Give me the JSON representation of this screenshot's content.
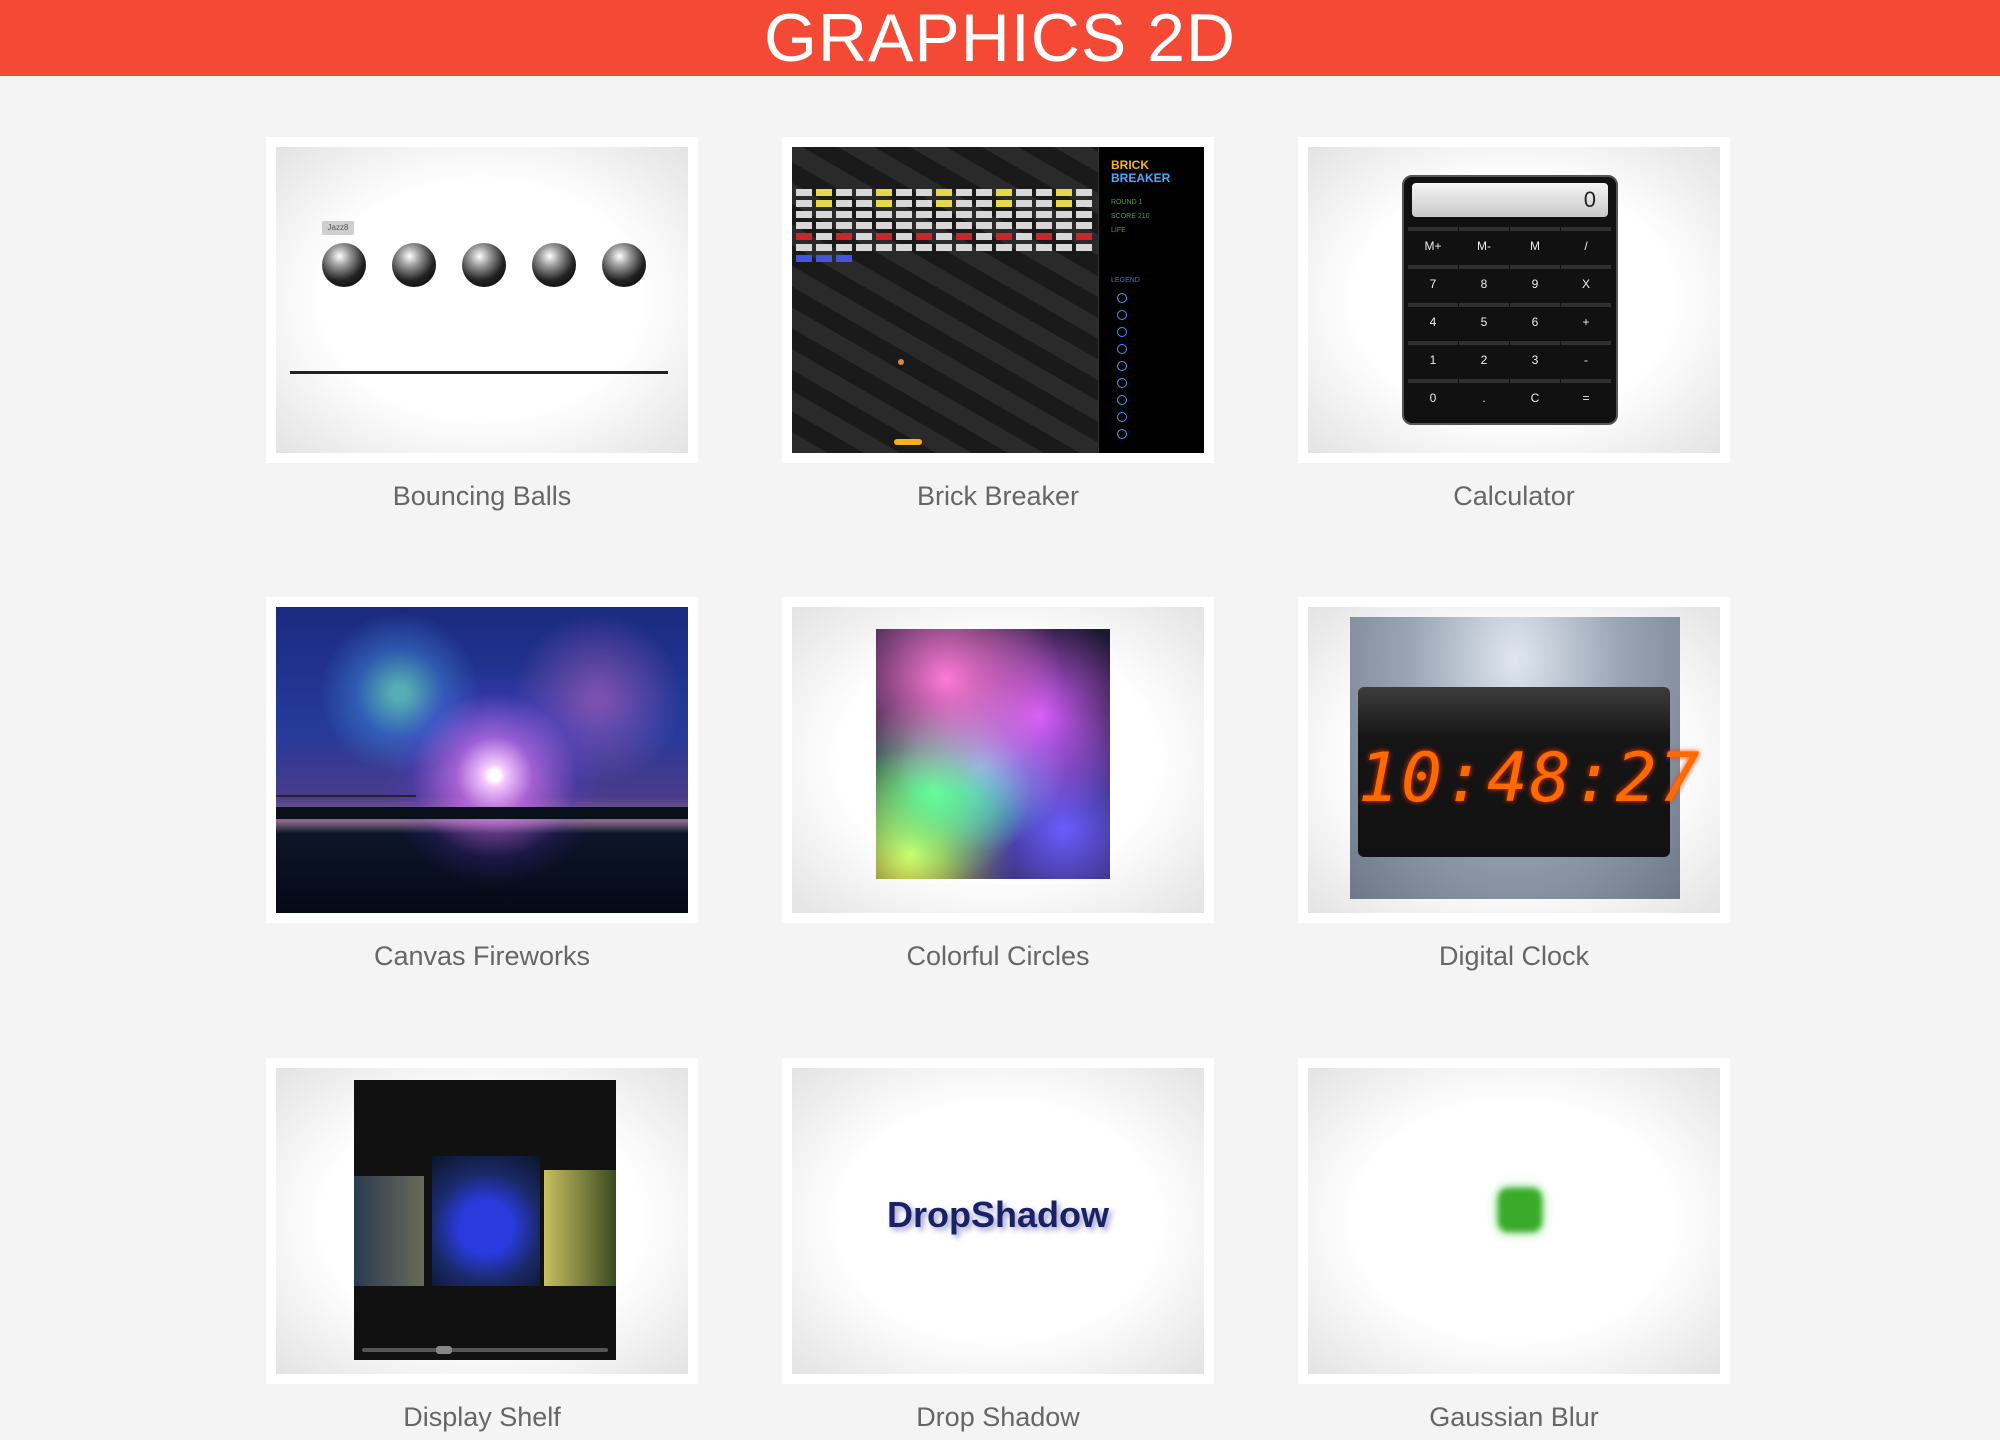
{
  "header": {
    "title": "GRAPHICS 2D"
  },
  "tiles": [
    {
      "caption": "Bouncing Balls"
    },
    {
      "caption": "Brick Breaker"
    },
    {
      "caption": "Calculator"
    },
    {
      "caption": "Canvas Fireworks"
    },
    {
      "caption": "Colorful Circles"
    },
    {
      "caption": "Digital Clock"
    },
    {
      "caption": "Display Shelf"
    },
    {
      "caption": "Drop Shadow"
    },
    {
      "caption": "Gaussian Blur"
    }
  ],
  "bouncing_balls": {
    "label": "Jazz8"
  },
  "brick_breaker": {
    "logo_line1": "BRICK",
    "logo_line2": "BREAKER",
    "round": "ROUND 1",
    "score": "SCORE 210",
    "life": "LIFE",
    "legend": "LEGEND"
  },
  "calculator": {
    "display": "0",
    "keys": [
      "M+",
      "M-",
      "M",
      "/",
      "7",
      "8",
      "9",
      "X",
      "4",
      "5",
      "6",
      "+",
      "1",
      "2",
      "3",
      "-",
      "0",
      ".",
      "C",
      "="
    ]
  },
  "digital_clock": {
    "time": "10:48:27"
  },
  "drop_shadow": {
    "text": "DropShadow"
  },
  "colors": {
    "header": "#f44a35",
    "background": "#f4f4f4",
    "caption": "#666666"
  }
}
